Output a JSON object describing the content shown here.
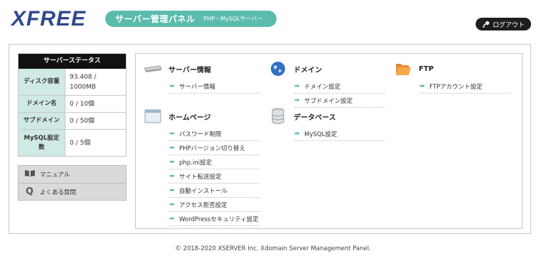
{
  "header": {
    "logo": "XFREE",
    "panel_title": "サーバー管理パネル",
    "panel_subtitle": "PHP・MySQLサーバー",
    "logout_label": "ログアウト"
  },
  "status": {
    "title": "サーバーステータス",
    "rows": [
      {
        "label": "ディスク容量",
        "value": "93.408 / 1000MB"
      },
      {
        "label": "ドメイン名",
        "value": "0 / 10個"
      },
      {
        "label": "サブドメイン",
        "value": "0 / 50個"
      },
      {
        "label": "MySQL設定数",
        "value": "0 / 5個"
      }
    ]
  },
  "help": {
    "manual": "マニュアル",
    "faq": "よくある質問"
  },
  "sections": {
    "server_info": {
      "title": "サーバー情報",
      "links": [
        "サーバー情報"
      ]
    },
    "homepage": {
      "title": "ホームページ",
      "links": [
        "パスワード制限",
        "PHPバージョン切り替え",
        "php.ini設定",
        "サイト転送設定",
        "自動インストール",
        "アクセス拒否設定",
        "WordPressセキュリティ設定"
      ]
    },
    "domain": {
      "title": "ドメイン",
      "links": [
        "ドメイン設定",
        "サブドメイン設定"
      ]
    },
    "database": {
      "title": "データベース",
      "links": [
        "MySQL設定"
      ]
    },
    "ftp": {
      "title": "FTP",
      "links": [
        "FTPアカウント設定"
      ]
    }
  },
  "icons": {
    "server": "server-icon",
    "homepage": "window-icon",
    "domain": "globe-icon",
    "database": "database-icon",
    "ftp": "folder-icon",
    "logout": "key-icon",
    "manual": "book-icon",
    "faq": "q-icon",
    "link_arrow": "arrow-right-icon"
  },
  "colors": {
    "accent": "#5bbcad",
    "logo": "#2d4a8a",
    "status_label_bg": "#cfe9e4"
  },
  "footer": "© 2018-2020 XSERVER Inc. Xdomain Server Management Panel."
}
